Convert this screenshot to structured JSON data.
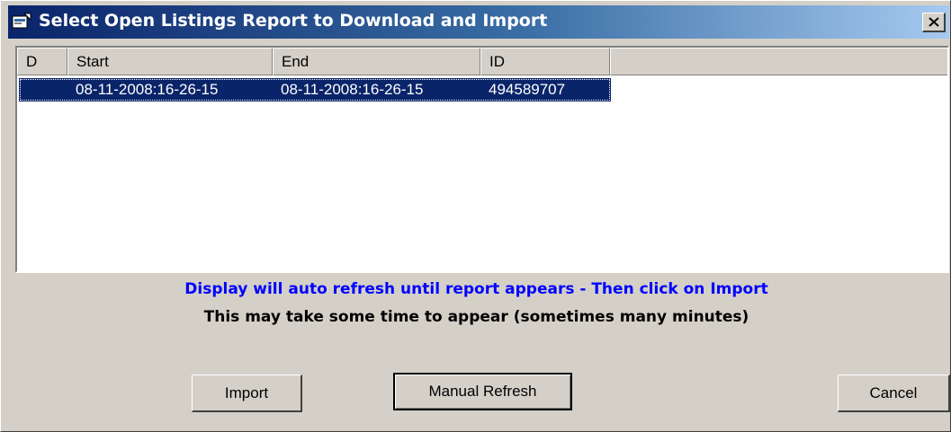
{
  "window": {
    "title": "Select Open Listings Report to Download and Import",
    "close_symbol": "×",
    "icon": "app-icon"
  },
  "list": {
    "columns": [
      "D",
      "Start",
      "End",
      "ID"
    ],
    "rows": [
      {
        "d": "",
        "start": "08-11-2008:16-26-15",
        "end": "08-11-2008:16-26-15",
        "id": "494589707",
        "selected": true
      }
    ]
  },
  "messages": {
    "info": "Display will auto refresh until report appears - Then click on Import",
    "note": "This may take some time to appear (sometimes many minutes)"
  },
  "buttons": {
    "import": "Import",
    "refresh": "Manual Refresh",
    "cancel": "Cancel"
  },
  "colors": {
    "titlebar_start": "#0a246a",
    "titlebar_end": "#a6caf0",
    "info_text": "#0000ff",
    "selection": "#0a246a",
    "face": "#d4d0c8"
  }
}
